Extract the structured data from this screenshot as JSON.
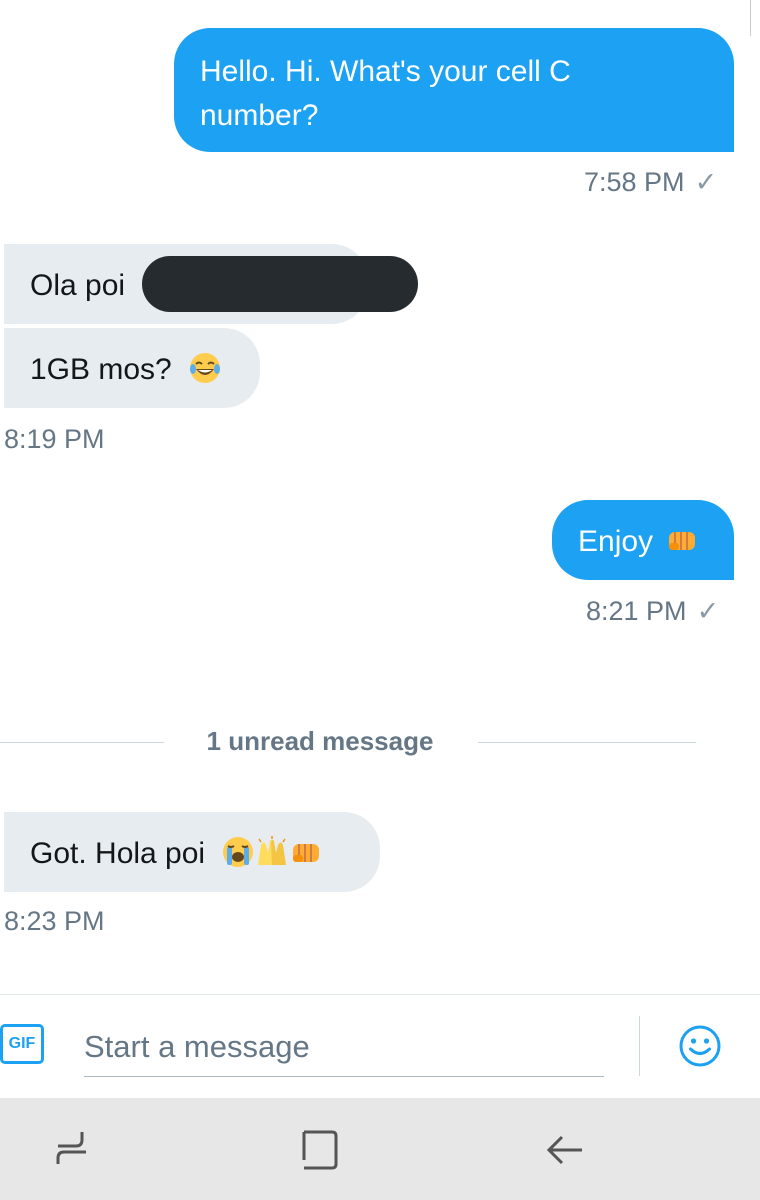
{
  "messages": [
    {
      "direction": "sent",
      "text": "Hello. Hi. What's your cell C",
      "text2": "number?"
    },
    {
      "direction": "received",
      "text": "Ola poi"
    },
    {
      "direction": "received",
      "text": "1GB mos?"
    },
    {
      "direction": "sent",
      "text": "Enjoy"
    },
    {
      "direction": "received",
      "text": "Got. Hola poi"
    }
  ],
  "timestamps": {
    "t1": "7:58 PM",
    "t2": "8:19 PM",
    "t3": "8:21 PM",
    "t4": "8:23 PM"
  },
  "check_glyph": "✓",
  "unread_divider": "1 unread message",
  "composer": {
    "gif_label": "GIF",
    "placeholder": "Start a message"
  },
  "icons": {
    "emoji_laugh": "tears-of-joy-emoji",
    "emoji_fist": "oncoming-fist-emoji",
    "emoji_cry": "loudly-crying-emoji",
    "emoji_hands": "raised-hands-emoji",
    "smiley": "smiley-icon",
    "nav_recents": "recents-icon",
    "nav_home": "home-icon",
    "nav_back": "back-icon"
  },
  "colors": {
    "sent_bubble": "#1da1f2",
    "received_bubble": "#e6ecf0",
    "accent": "#1da1f2",
    "muted_text": "#657786"
  }
}
